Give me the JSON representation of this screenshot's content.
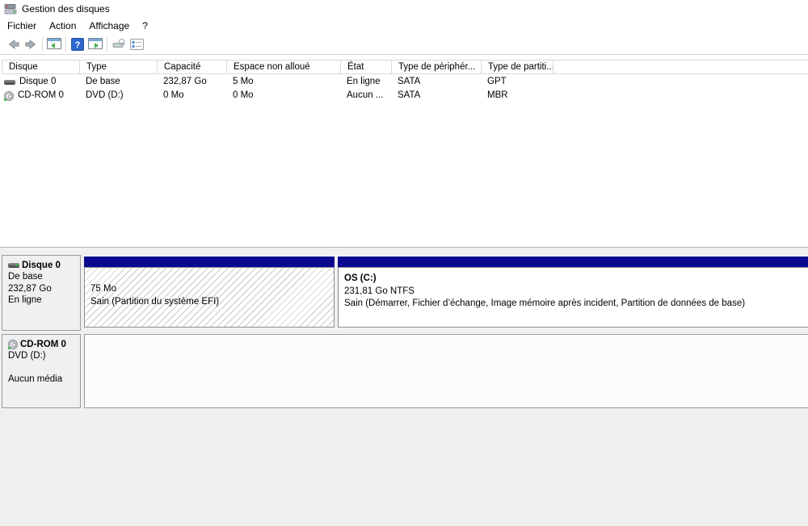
{
  "window": {
    "title": "Gestion des disques"
  },
  "menu": {
    "items": [
      "Fichier",
      "Action",
      "Affichage",
      "?"
    ]
  },
  "toolbar": {
    "icons": [
      "back",
      "forward",
      "console-tree",
      "help",
      "action-pane",
      "drive-tools",
      "properties-list"
    ]
  },
  "list": {
    "columns": [
      "Disque",
      "Type",
      "Capacité",
      "Espace non alloué",
      "État",
      "Type de périphér...",
      "Type de partiti..."
    ],
    "rows": [
      {
        "cells": [
          "Disque 0",
          "De base",
          "232,87 Go",
          "5 Mo",
          "En ligne",
          "SATA",
          "GPT"
        ]
      },
      {
        "cells": [
          "CD-ROM 0",
          "DVD (D:)",
          "0 Mo",
          "0 Mo",
          "Aucun ...",
          "SATA",
          "MBR"
        ]
      }
    ]
  },
  "graphical": {
    "disk0": {
      "title": "Disque 0",
      "lines": [
        "De base",
        "232,87 Go",
        "En ligne"
      ],
      "efi": {
        "size": "75 Mo",
        "status": "Sain (Partition du système EFI)"
      },
      "os": {
        "name": "OS (C:)",
        "capacity": "231,81 Go NTFS",
        "status": "Sain (Démarrer, Fichier d’échange, Image mémoire après incident, Partition de données de base)"
      }
    },
    "cdrom0": {
      "title": "CD-ROM 0",
      "type": "DVD (D:)",
      "status": "Aucun média"
    }
  },
  "colors": {
    "partition_band": "#0a0a91",
    "help_blue": "#2e68cf",
    "action_green": "#3fae49",
    "hatch_line": "#c9c9c9",
    "panel_gray": "#f0f0f0"
  }
}
